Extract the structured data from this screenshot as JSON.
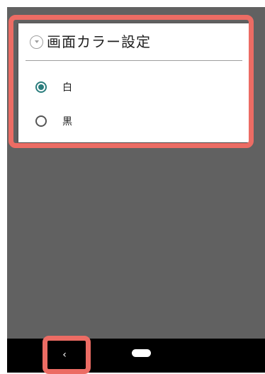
{
  "dialog": {
    "title": "画面カラー設定",
    "options": [
      {
        "label": "白",
        "selected": true
      },
      {
        "label": "黒",
        "selected": false
      }
    ]
  },
  "navbar": {
    "back_glyph": "‹"
  },
  "colors": {
    "accent": "#2b7d7d",
    "highlight": "#ec6c64",
    "screen_background": "#616161",
    "navbar": "#000000"
  }
}
